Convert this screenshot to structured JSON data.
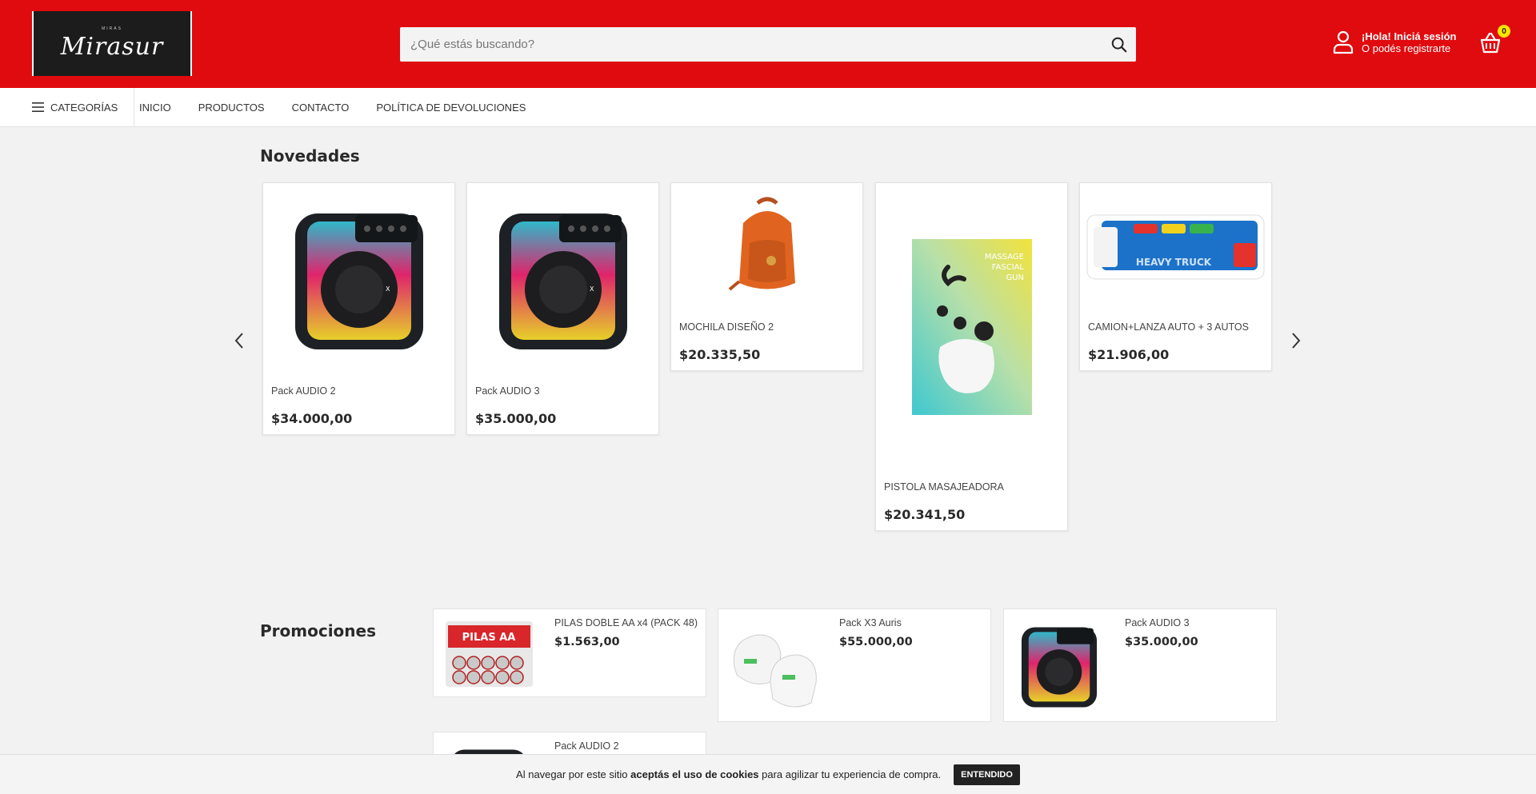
{
  "header": {
    "logo_top": "MIRAS",
    "logo_text": "Mirasur",
    "search_placeholder": "¿Qué estás buscando?",
    "user_greeting": "¡Hola! Iniciá sesión",
    "user_register": "O podés registrarte",
    "cart_count": "0"
  },
  "nav": {
    "categories": "CATEGORÍAS",
    "links": [
      "INICIO",
      "PRODUCTOS",
      "CONTACTO",
      "POLÍTICA DE DEVOLUCIONES"
    ]
  },
  "novedades": {
    "title": "Novedades",
    "products": [
      {
        "name": "Pack AUDIO 2",
        "price": "$34.000,00",
        "image": "speaker"
      },
      {
        "name": "Pack AUDIO 3",
        "price": "$35.000,00",
        "image": "speaker"
      },
      {
        "name": "MOCHILA DISEÑO 2",
        "price": "$20.335,50",
        "image": "backpack"
      },
      {
        "name": "PISTOLA MASAJEADORA",
        "price": "$20.341,50",
        "image": "massage-gun-box"
      },
      {
        "name": "CAMION+LANZA AUTO + 3 AUTOS",
        "price": "$21.906,00",
        "image": "toy-truck"
      }
    ]
  },
  "promociones": {
    "title": "Promociones",
    "products": [
      {
        "name": "PILAS DOBLE AA x4 (PACK 48)",
        "price": "$1.563,00",
        "image": "batteries"
      },
      {
        "name": "Pack X3 Auris",
        "price": "$55.000,00",
        "image": "earbuds"
      },
      {
        "name": "Pack AUDIO 3",
        "price": "$35.000,00",
        "image": "speaker"
      },
      {
        "name": "Pack AUDIO 2",
        "price": "",
        "image": "speaker"
      }
    ]
  },
  "cookie": {
    "text_before": "Al navegar por este sitio ",
    "text_bold": "aceptás el uso de cookies",
    "text_after": " para agilizar tu experiencia de compra.",
    "button": "ENTENDIDO"
  },
  "colors": {
    "brand_red": "#e00b0f",
    "badge_yellow": "#ffe500"
  }
}
